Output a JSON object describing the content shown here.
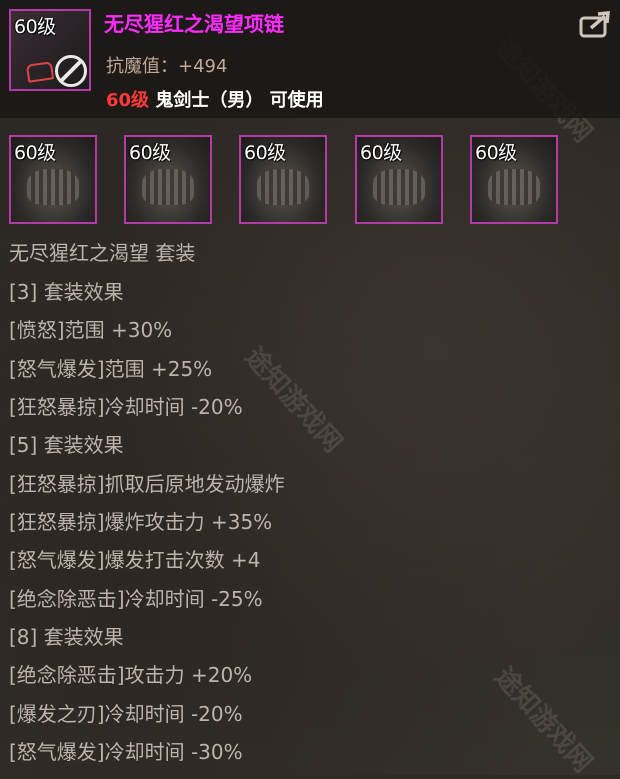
{
  "item": {
    "level": "60级",
    "name": "无尽猩红之渴望项链",
    "stat": "抗魔值：+494",
    "req_level": "60级",
    "req_class": " 鬼剑士（男） 可使用",
    "border_color": "#b43aa8",
    "name_color": "#ff2bff"
  },
  "set_pieces": [
    {
      "level": "60级"
    },
    {
      "level": "60级"
    },
    {
      "level": "60级"
    },
    {
      "level": "60级"
    },
    {
      "level": "60级"
    }
  ],
  "set": {
    "title": "无尽猩红之渴望  套装",
    "lines": [
      "[3] 套装效果",
      "[愤怒]范围 +30%",
      "[怒气爆发]范围 +25%",
      "[狂怒暴掠]冷却时间 -20%",
      "[5] 套装效果",
      "[狂怒暴掠]抓取后原地发动爆炸",
      "[狂怒暴掠]爆炸攻击力 +35%",
      "[怒气爆发]爆发打击次数 +4",
      "[绝念除恶击]冷却时间 -25%",
      "[8] 套装效果",
      "[绝念除恶击]攻击力 +20%",
      "[爆发之刃]冷却时间 -20%",
      "[怒气爆发]冷却时间 -30%"
    ]
  },
  "watermark": "途知游戏网",
  "icons": {
    "share": "share-icon",
    "forbidden": "no-entry-icon"
  }
}
